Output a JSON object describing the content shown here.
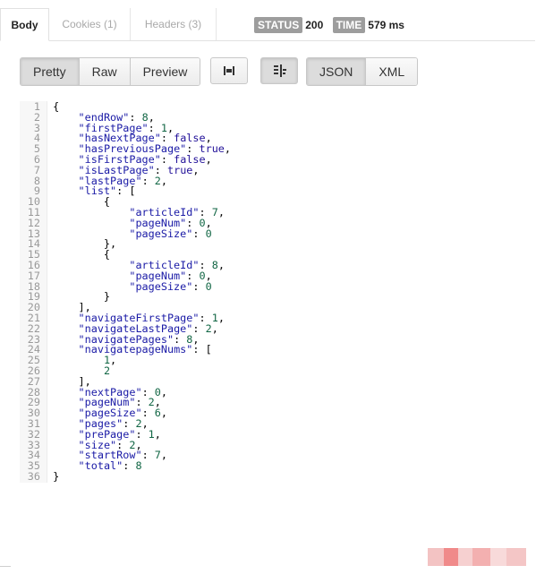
{
  "tabs": {
    "body": "Body",
    "cookies": "Cookies (1)",
    "headers": "Headers (3)"
  },
  "status": {
    "status_label": "STATUS",
    "status_value": "200",
    "time_label": "TIME",
    "time_value": "579 ms"
  },
  "toolbar": {
    "pretty": "Pretty",
    "raw": "Raw",
    "preview": "Preview",
    "wrap_icon": "wrap-lines-icon",
    "indent_icon": "indent-icon",
    "json": "JSON",
    "xml": "XML"
  },
  "code_lines": [
    "{",
    "    \"endRow\": 8,",
    "    \"firstPage\": 1,",
    "    \"hasNextPage\": false,",
    "    \"hasPreviousPage\": true,",
    "    \"isFirstPage\": false,",
    "    \"isLastPage\": true,",
    "    \"lastPage\": 2,",
    "    \"list\": [",
    "        {",
    "            \"articleId\": 7,",
    "            \"pageNum\": 0,",
    "            \"pageSize\": 0",
    "        },",
    "        {",
    "            \"articleId\": 8,",
    "            \"pageNum\": 0,",
    "            \"pageSize\": 0",
    "        }",
    "    ],",
    "    \"navigateFirstPage\": 1,",
    "    \"navigateLastPage\": 2,",
    "    \"navigatePages\": 8,",
    "    \"navigatepageNums\": [",
    "        1,",
    "        2",
    "    ],",
    "    \"nextPage\": 0,",
    "    \"pageNum\": 2,",
    "    \"pageSize\": 6,",
    "    \"pages\": 2,",
    "    \"prePage\": 1,",
    "    \"size\": 2,",
    "    \"startRow\": 7,",
    "    \"total\": 8",
    "}"
  ],
  "colors": {
    "key": "#1a1aa6",
    "number": "#116644",
    "boolean": "#221199",
    "status_badge": "#9d9d9d"
  }
}
